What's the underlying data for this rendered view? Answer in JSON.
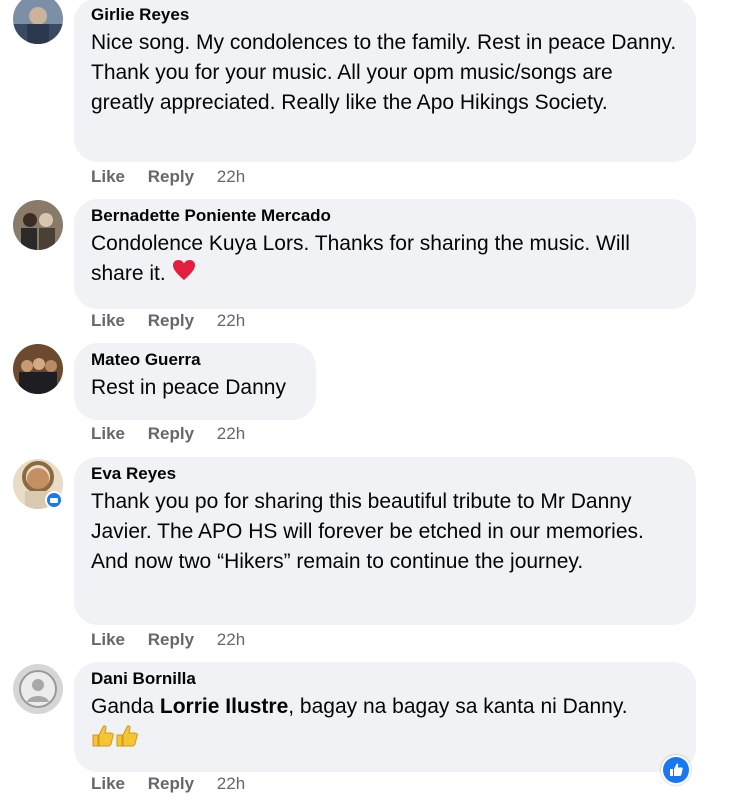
{
  "comments": [
    {
      "author": "Girlie Reyes",
      "text": "Nice song. My condolences to the family. Rest in peace Danny. Thank you for your music. All your opm music/songs are greatly appreciated. Really like the Apo Hikings Society.",
      "like": "Like",
      "reply": "Reply",
      "time": "22h"
    },
    {
      "author": "Bernadette Poniente Mercado",
      "text": "Condolence Kuya Lors. Thanks for sharing the music. Will share it.",
      "emoji": "heart-icon",
      "like": "Like",
      "reply": "Reply",
      "time": "22h"
    },
    {
      "author": "Mateo Guerra",
      "text": "Rest in peace Danny",
      "like": "Like",
      "reply": "Reply",
      "time": "22h"
    },
    {
      "author": "Eva Reyes",
      "text": "Thank you po for sharing this beautiful tribute to Mr Danny Javier. The APO HS will forever be etched in our memories. And now two “Hikers” remain to continue the journey.",
      "like": "Like",
      "reply": "Reply",
      "time": "22h"
    },
    {
      "author": "Dani Bornilla",
      "text_before": "Ganda ",
      "mention": "Lorrie Ilustre",
      "text_after": ", bagay na bagay sa kanta ni Danny.",
      "emoji": "thumbs-up-icon",
      "like": "Like",
      "reply": "Reply",
      "time": "22h"
    }
  ],
  "colors": {
    "bubble": "#f0f2f5",
    "action_text": "#65676b",
    "like_blue": "#1877f2",
    "heart_red": "#e41e3f"
  }
}
